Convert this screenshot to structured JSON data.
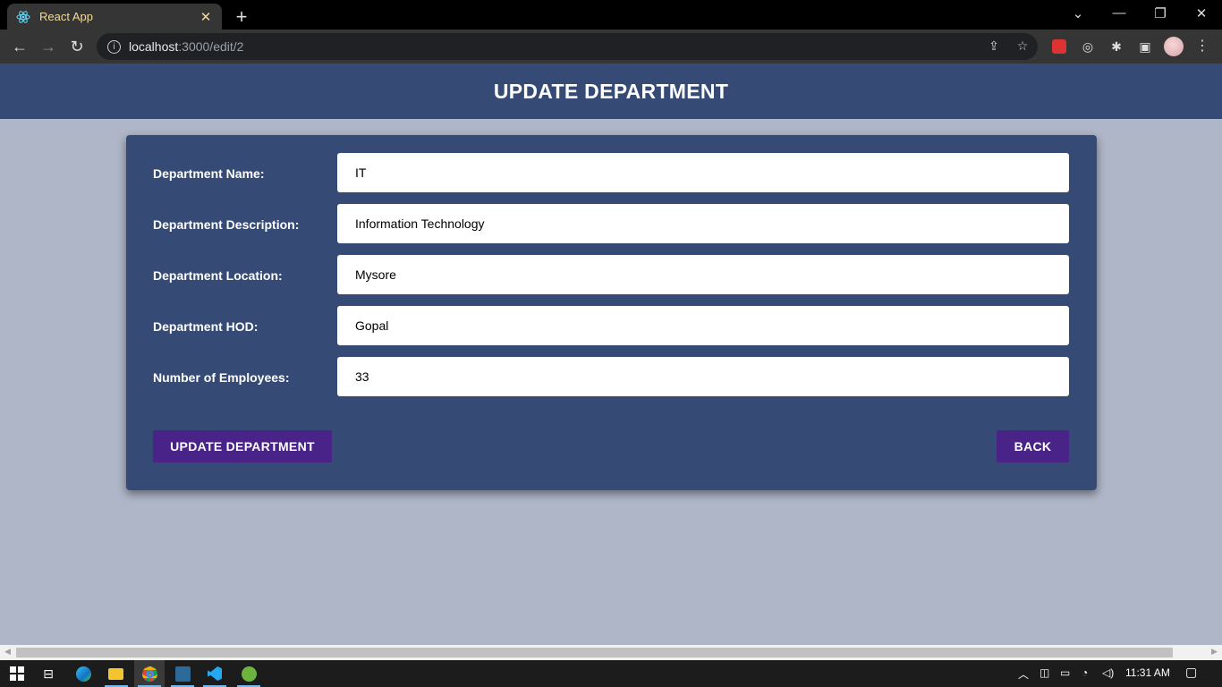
{
  "browser": {
    "tab_title": "React App",
    "url_host": "localhost",
    "url_path": ":3000/edit/2",
    "new_tab": "+",
    "close_tab": "✕"
  },
  "page": {
    "title": "UPDATE DEPARTMENT"
  },
  "form": {
    "fields": [
      {
        "label": "Department Name:",
        "value": "IT"
      },
      {
        "label": "Department Description:",
        "value": "Information Technology"
      },
      {
        "label": "Department Location:",
        "value": "Mysore"
      },
      {
        "label": "Department HOD:",
        "value": "Gopal"
      },
      {
        "label": "Number of Employees:",
        "value": "33"
      }
    ],
    "submit_label": "UPDATE DEPARTMENT",
    "back_label": "BACK"
  },
  "taskbar": {
    "time": "11:31 AM"
  },
  "colors": {
    "header_bg": "#354b76",
    "page_bg": "#aeb6c8",
    "button_bg": "#4a2388",
    "tab_text": "#f2dc9a"
  }
}
